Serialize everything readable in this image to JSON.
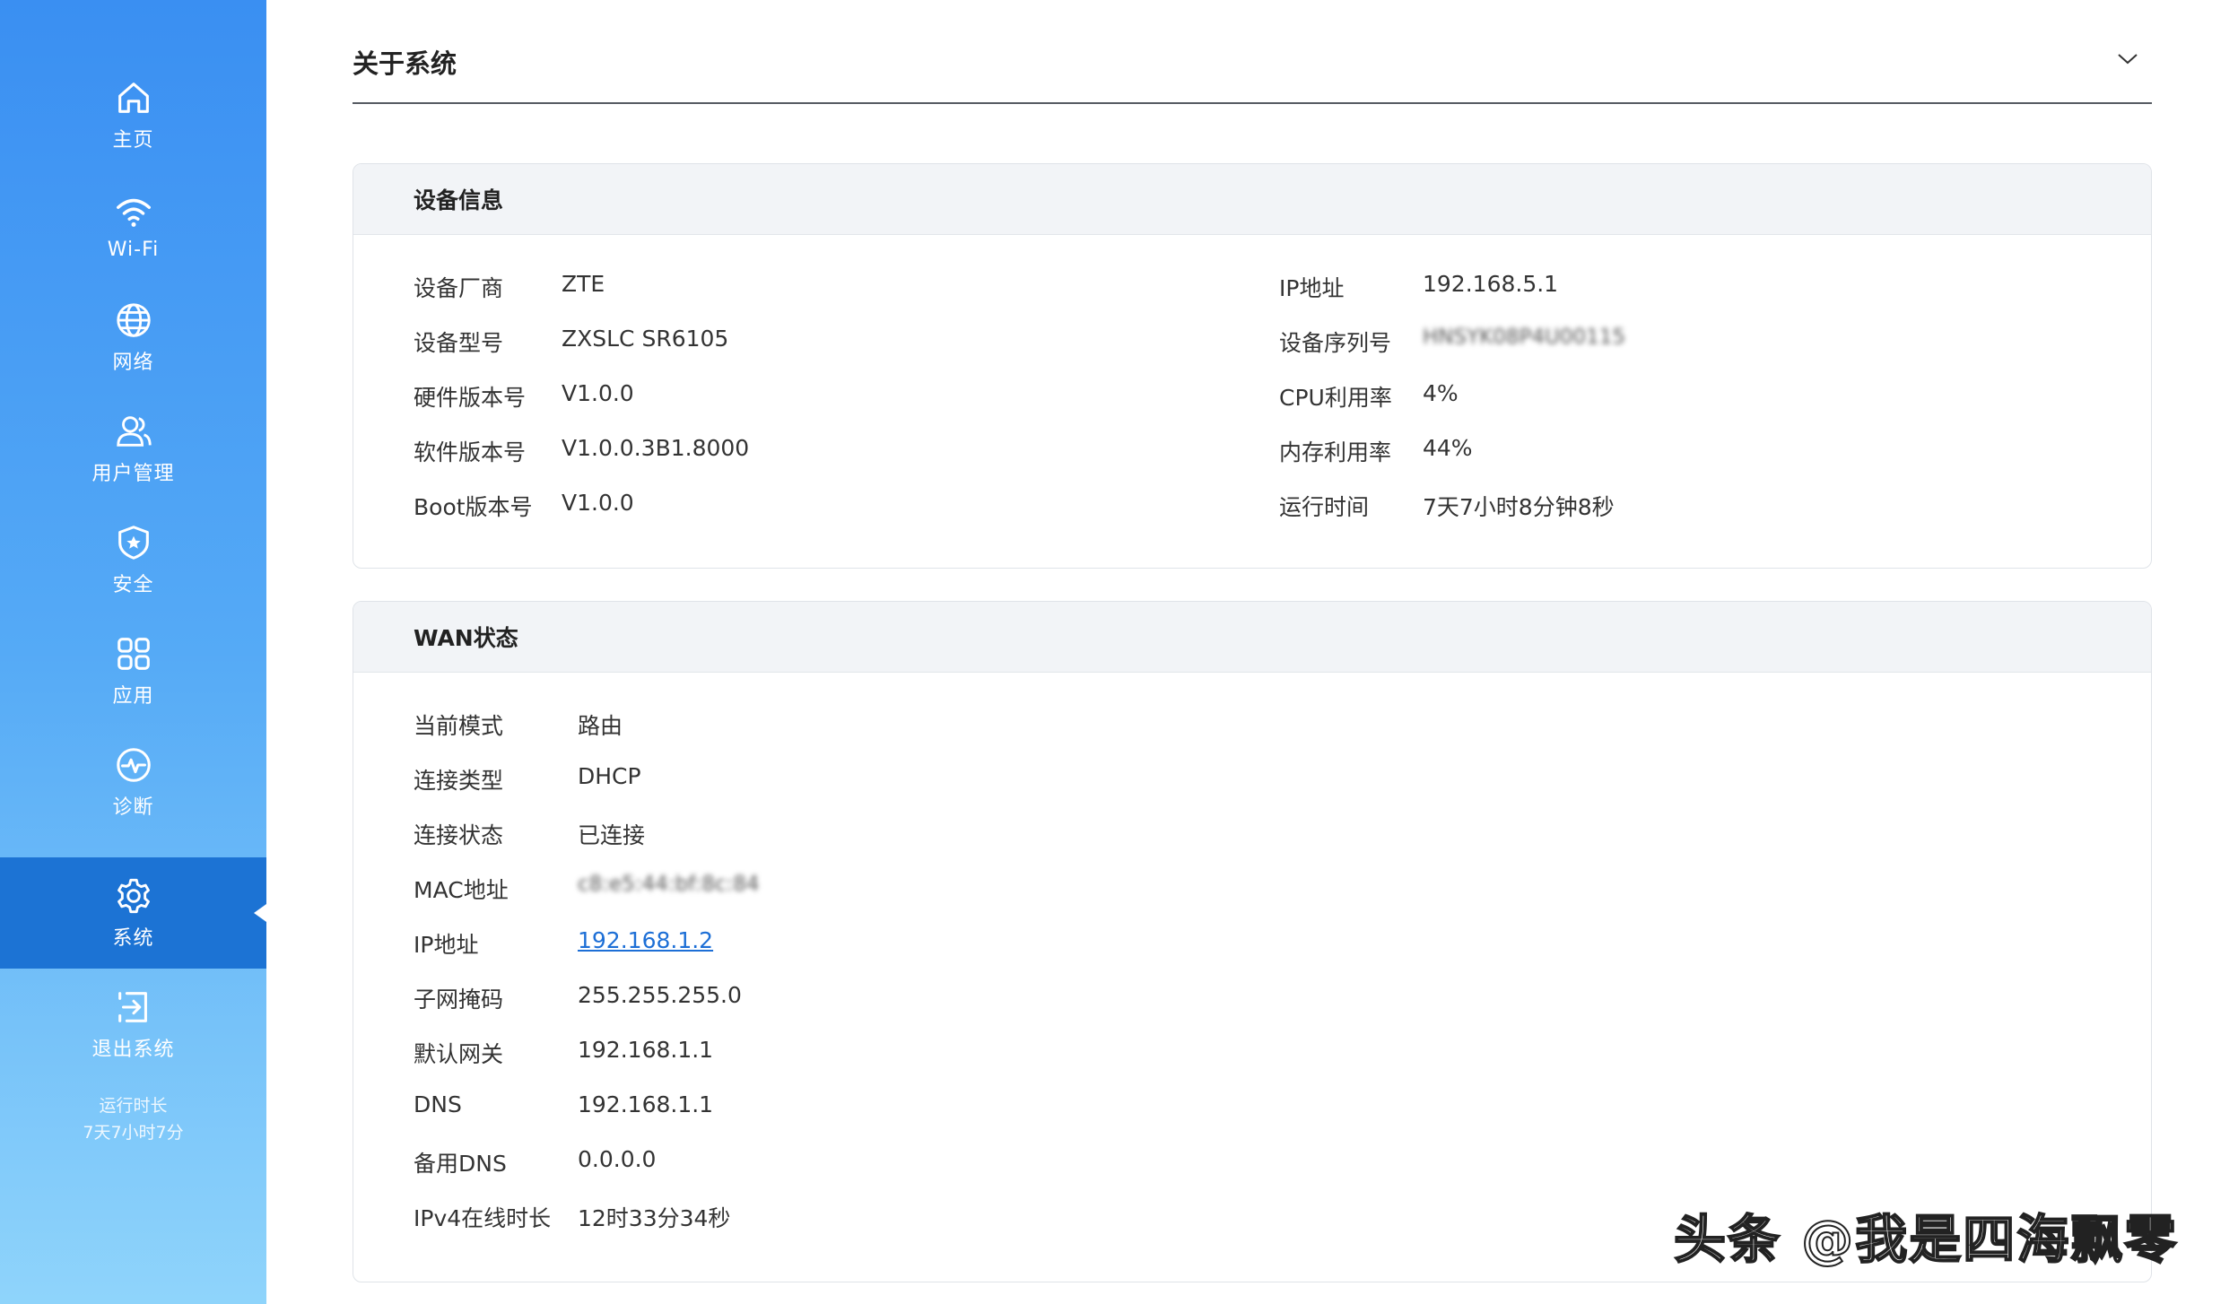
{
  "sidebar": {
    "items": [
      {
        "label": "主页",
        "icon": "home-icon"
      },
      {
        "label": "Wi-Fi",
        "icon": "wifi-icon"
      },
      {
        "label": "网络",
        "icon": "globe-icon"
      },
      {
        "label": "用户管理",
        "icon": "users-icon"
      },
      {
        "label": "安全",
        "icon": "shield-icon"
      },
      {
        "label": "应用",
        "icon": "apps-grid-icon"
      },
      {
        "label": "诊断",
        "icon": "diagnose-icon"
      },
      {
        "label": "系统",
        "icon": "gear-icon",
        "active": true
      },
      {
        "label": "退出系统",
        "icon": "logout-icon"
      }
    ],
    "runtime_label": "运行时长",
    "runtime_value": "7天7小时7分"
  },
  "page": {
    "title": "关于系统"
  },
  "device_info": {
    "title": "设备信息",
    "left": [
      {
        "label": "设备厂商",
        "value": "ZTE"
      },
      {
        "label": "设备型号",
        "value": "ZXSLC SR6105"
      },
      {
        "label": "硬件版本号",
        "value": "V1.0.0"
      },
      {
        "label": "软件版本号",
        "value": "V1.0.0.3B1.8000"
      },
      {
        "label": "Boot版本号",
        "value": "V1.0.0"
      }
    ],
    "right": [
      {
        "label": "IP地址",
        "value": "192.168.5.1"
      },
      {
        "label": "设备序列号",
        "value": "HNSYK08P4U00115"
      },
      {
        "label": "CPU利用率",
        "value": "4%"
      },
      {
        "label": "内存利用率",
        "value": "44%"
      },
      {
        "label": "运行时间",
        "value": "7天7小时8分钟8秒"
      }
    ]
  },
  "wan_status": {
    "title": "WAN状态",
    "rows": [
      {
        "label": "当前模式",
        "value": "路由"
      },
      {
        "label": "连接类型",
        "value": "DHCP"
      },
      {
        "label": "连接状态",
        "value": "已连接"
      },
      {
        "label": "MAC地址",
        "value": "c8:e5:44:bf:8c:84"
      },
      {
        "label": "IP地址",
        "value": "192.168.1.2"
      },
      {
        "label": "子网掩码",
        "value": "255.255.255.0"
      },
      {
        "label": "默认网关",
        "value": "192.168.1.1"
      },
      {
        "label": "DNS",
        "value": "192.168.1.1"
      },
      {
        "label": "备用DNS",
        "value": "0.0.0.0"
      },
      {
        "label": "IPv4在线时长",
        "value": "12时33分34秒"
      }
    ]
  },
  "watermark": "头条 @我是四海飘零"
}
